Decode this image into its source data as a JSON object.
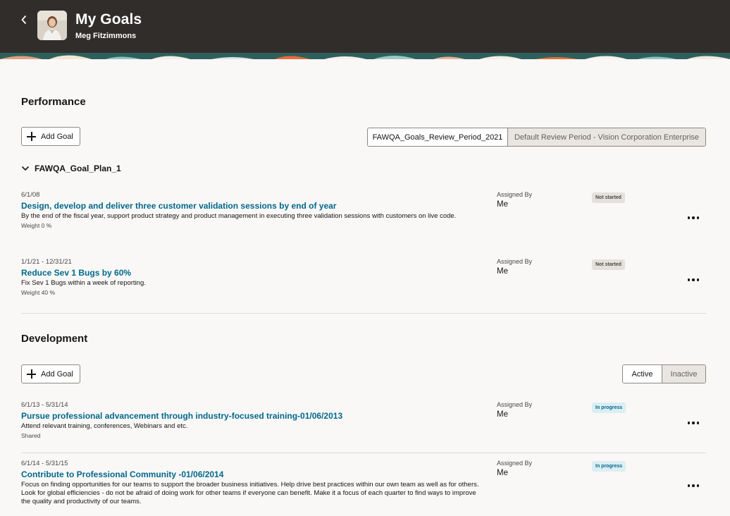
{
  "header": {
    "title": "My Goals",
    "subtitle": "Meg Fitzimmons",
    "back_icon": "chevron-left-icon",
    "avatar": "user-photo"
  },
  "performance": {
    "title": "Performance",
    "add_goal_label": "Add Goal",
    "review_periods": [
      {
        "label": "FAWQA_Goals_Review_Period_2021",
        "selected": true
      },
      {
        "label": "Default Review Period - Vision Corporation Enterprise",
        "selected": false
      }
    ],
    "plan": {
      "name": "FAWQA_Goal_Plan_1",
      "expanded": true,
      "goals": [
        {
          "dates": "6/1/08",
          "name": "Design, develop and deliver three customer validation sessions by end of year",
          "description": "By the end of the fiscal year, support product strategy and product management in executing three validation sessions with customers on live code.",
          "meta": "Weight 0 %",
          "assigned_by_label": "Assigned By",
          "assigned_by": "Me",
          "status": "Not started"
        },
        {
          "dates": "1/1/21 - 12/31/21",
          "name": "Reduce Sev 1 Bugs by 60%",
          "description": "Fix Sev 1 Bugs within a week of reporting.",
          "meta": "Weight 40 %",
          "assigned_by_label": "Assigned By",
          "assigned_by": "Me",
          "status": "Not started"
        }
      ]
    }
  },
  "development": {
    "title": "Development",
    "add_goal_label": "Add Goal",
    "filter": [
      {
        "label": "Active",
        "selected": true
      },
      {
        "label": "Inactive",
        "selected": false
      }
    ],
    "goals": [
      {
        "dates": "6/1/13 - 5/31/14",
        "name": "Pursue professional advancement through industry-focused training-01/06/2013",
        "description": "Attend relevant training, conferences, Webinars and etc.",
        "meta": "Shared",
        "assigned_by_label": "Assigned By",
        "assigned_by": "Me",
        "status": "In progress"
      },
      {
        "dates": "6/1/14 - 5/31/15",
        "name": "Contribute to Professional Community -01/06/2014",
        "description": "Focus on finding opportunities for our teams to support the broader business initiatives. Help drive best practices within our own team as well as for others. Look for global efficiencies - do not be afraid of doing work for other teams if everyone can benefit. Make it a focus of each quarter to find ways to improve the quality and productivity of our teams.",
        "meta": "",
        "assigned_by_label": "Assigned By",
        "assigned_by": "Me",
        "status": "In progress"
      }
    ]
  },
  "colors": {
    "header_bg": "#312d2a",
    "link": "#00688c",
    "badge_not_started": "#e4e1dd",
    "badge_in_progress": "#dbeef4",
    "page_bg": "#f9f8f6"
  }
}
